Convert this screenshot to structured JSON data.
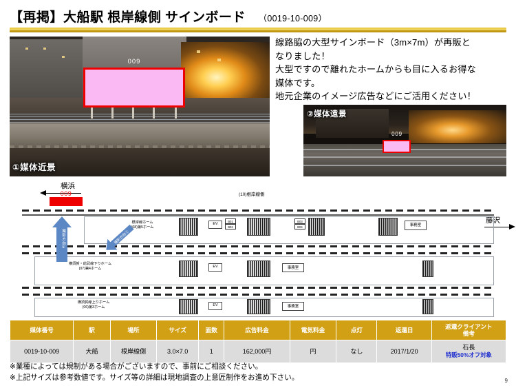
{
  "slide": {
    "title_main": "【再掲】大船駅 根岸線側 サインボード",
    "title_code": "（0019-10-009）",
    "page_number": "9"
  },
  "description": {
    "line1": "線路脇の大型サインボード（3m×7m）が再販と",
    "line2": "なりました！",
    "line3": "大型ですので離れたホームからも目に入るお得な",
    "line4": "媒体です。",
    "line5": "地元企業のイメージ広告などにご活用ください！"
  },
  "photos": {
    "photo1": {
      "caption": "①媒体近景",
      "board_id": "009",
      "board_fill": "#fbb9f4",
      "board_border": "#ee0000"
    },
    "photo2": {
      "caption": "②媒体遠景",
      "board_id": "009",
      "board_fill": "#fbb9f4",
      "board_border": "#ee0000"
    }
  },
  "diagram": {
    "left_direction": "横浜",
    "right_direction": "藤沢",
    "media_marker_id": "009",
    "media_marker_color": "#ee0000",
    "top_side_label": "(10)根岸線側",
    "shoot_arrow_1": "撮影方向①",
    "shoot_arrow_2": "撮影方向②",
    "platforms": [
      {
        "name": "根岸線ホーム",
        "sub": "(08)第5ホーム"
      },
      {
        "name": "横須賀・総武線下りホーム",
        "sub": "(07)第4ホーム"
      },
      {
        "name": "横須賀線上りホーム",
        "sub": "(06)第3ホーム"
      }
    ],
    "ev_label": "EV",
    "office_label": "事務室",
    "board_codes_1": [
      "B01",
      "B02"
    ],
    "board_codes_2": [
      "B03",
      "B04"
    ]
  },
  "table": {
    "headers": [
      "媒体番号",
      "駅",
      "場所",
      "サイズ",
      "面数",
      "広告料金",
      "電気料金",
      "点灯",
      "返還日",
      "返還クライアント\n備考"
    ],
    "header_client_line1": "返還クライアント",
    "header_client_line2": "備考",
    "row": {
      "media_no": "0019-10-009",
      "station": "大船",
      "place": "根岸線側",
      "size": "3.0×7.0",
      "faces": "1",
      "ad_fee": "162,000円",
      "electric_fee": "円",
      "lighting": "なし",
      "return_date": "2017/1/20",
      "client_name": "石長",
      "client_note": "特販50%オフ対象"
    }
  },
  "notes": {
    "note1": "※業種によっては規制がある場合がございますので、事前にご相談ください。",
    "note2": "※上記サイズは参考数値です。サイズ等の詳細は現地調査の上意匠制作をお進め下さい。"
  }
}
